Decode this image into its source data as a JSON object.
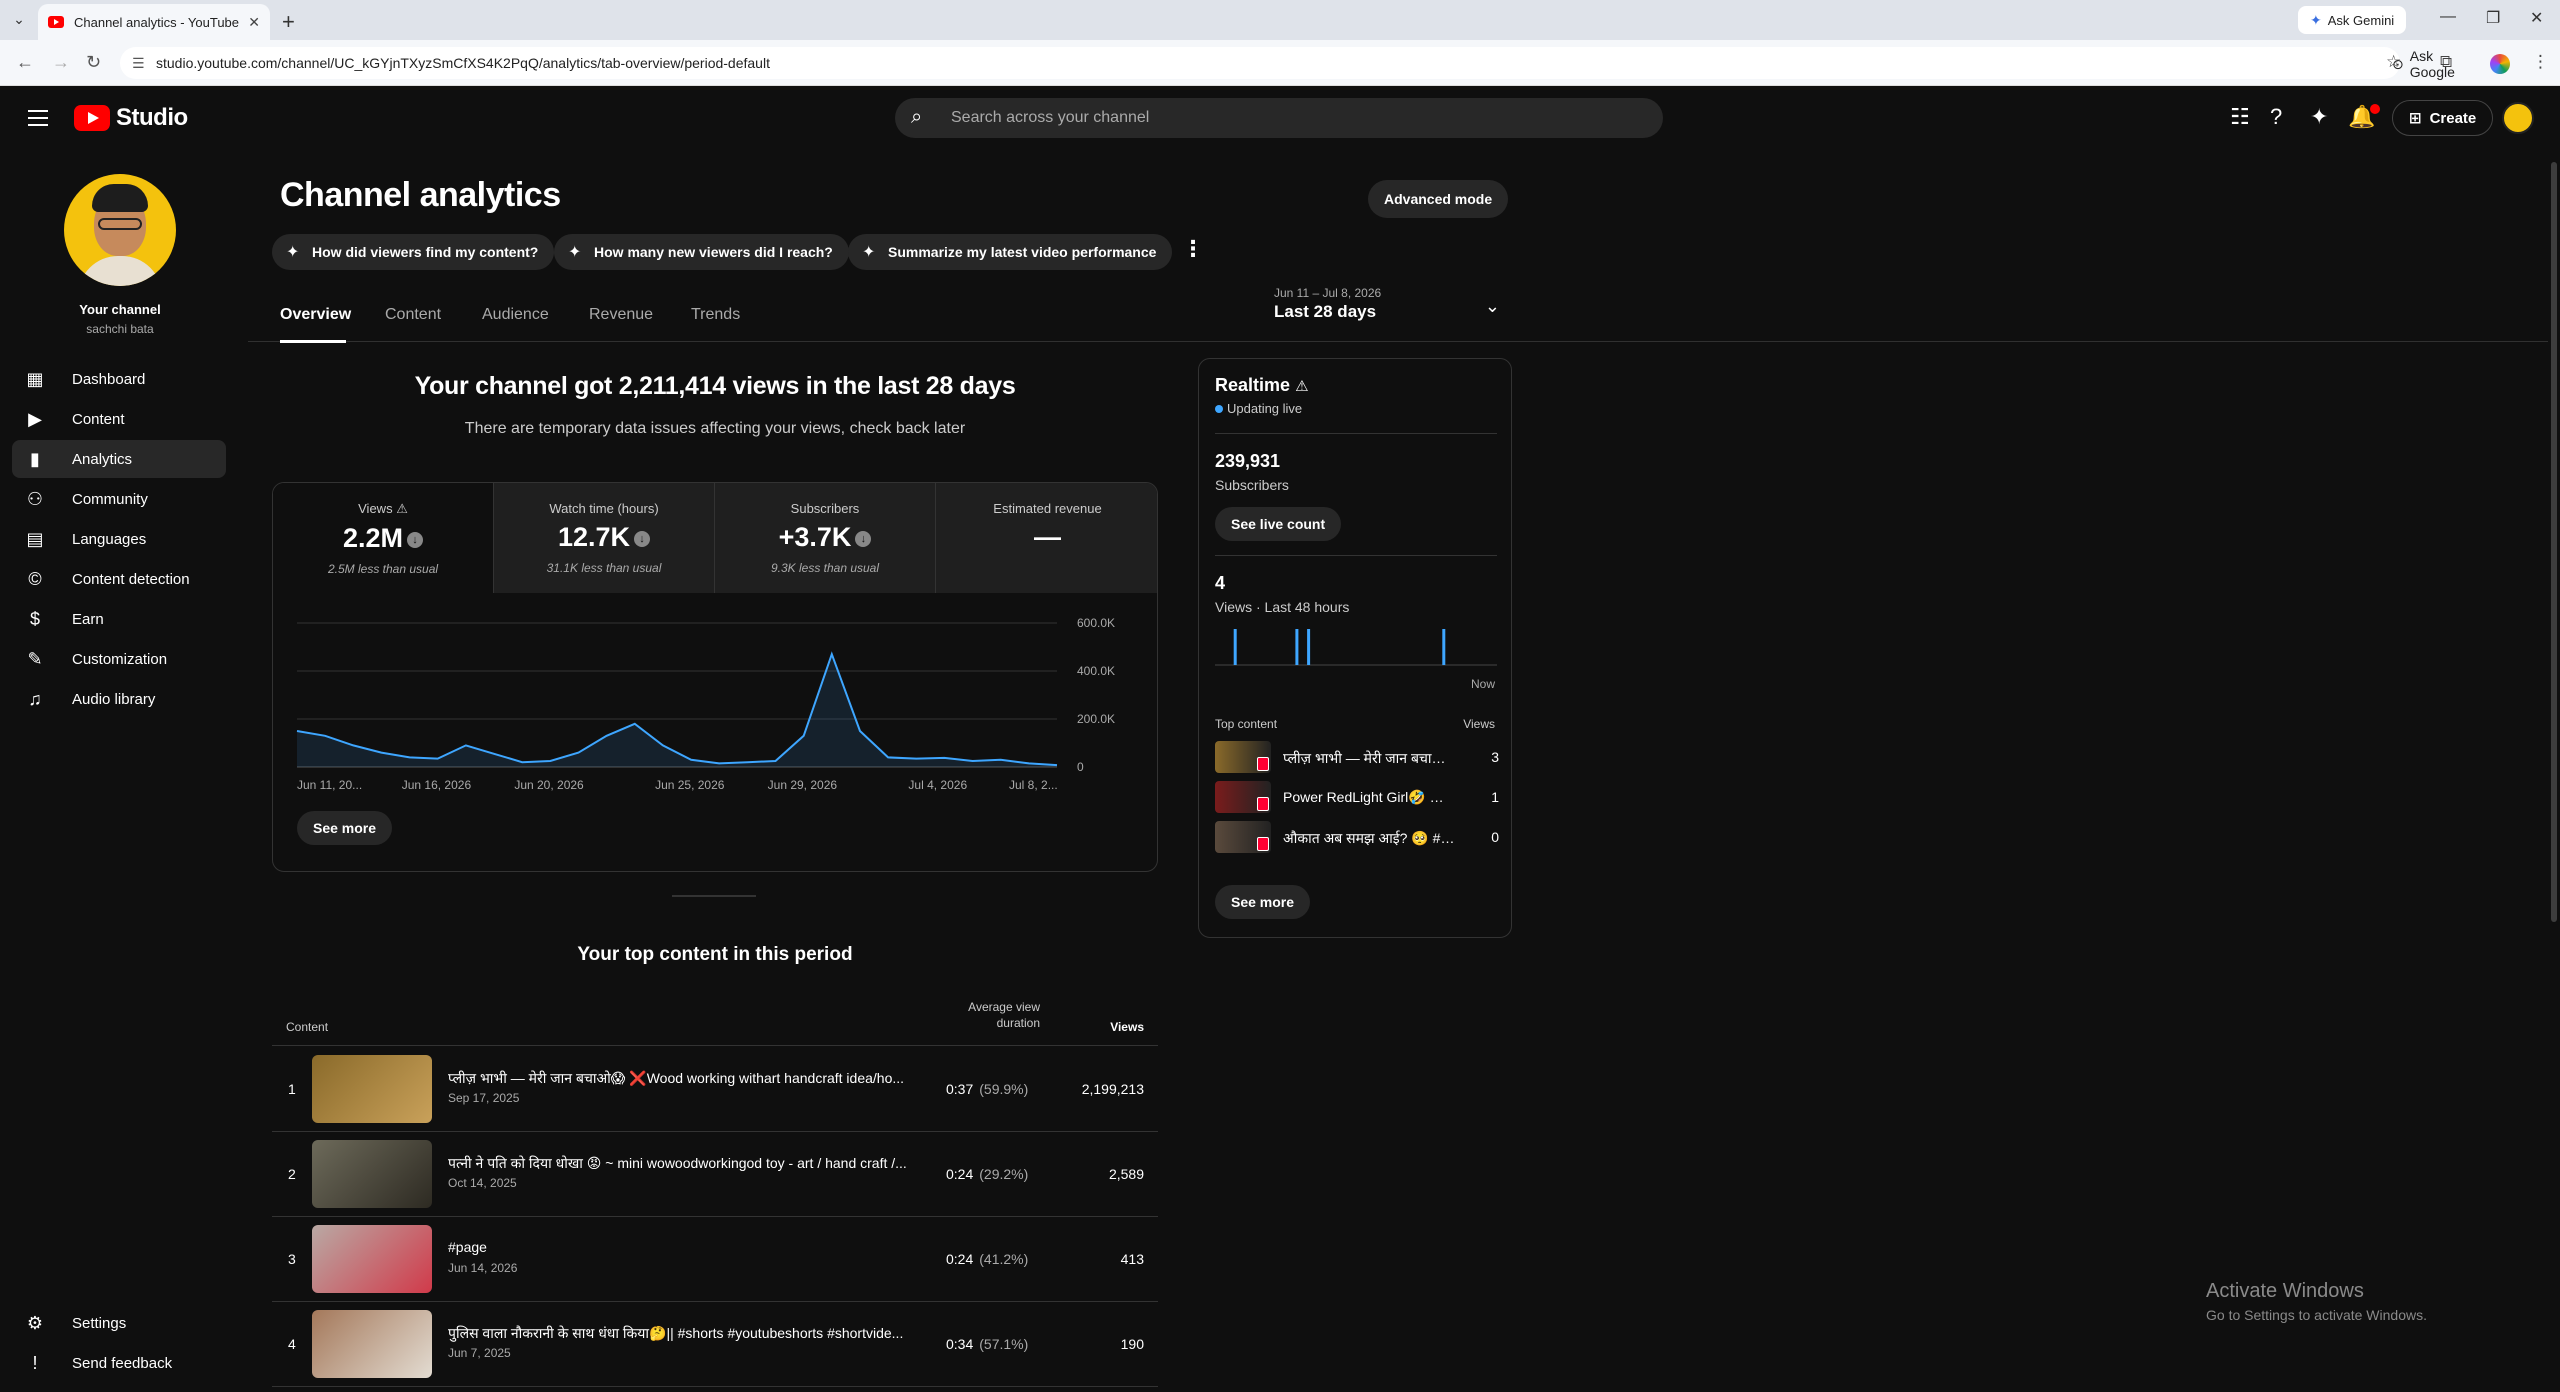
{
  "browser": {
    "tab_title": "Channel analytics - YouTube Studio",
    "url": "studio.youtube.com/channel/UC_kGYjnTXyzSmCfXS4K2PqQ/analytics/tab-overview/period-default",
    "ask_gemini": "Ask Gemini",
    "ask_google": "Ask Google"
  },
  "header": {
    "logo_text": "Studio",
    "search_placeholder": "Search across your channel",
    "create_label": "Create"
  },
  "sidebar": {
    "channel_name": "Your channel",
    "channel_handle": "sachchi bata",
    "items": [
      {
        "label": "Dashboard",
        "icon": "dashboard-icon"
      },
      {
        "label": "Content",
        "icon": "content-icon"
      },
      {
        "label": "Analytics",
        "icon": "analytics-icon",
        "active": true
      },
      {
        "label": "Community",
        "icon": "community-icon"
      },
      {
        "label": "Languages",
        "icon": "languages-icon"
      },
      {
        "label": "Content detection",
        "icon": "copyright-icon"
      },
      {
        "label": "Earn",
        "icon": "dollar-icon"
      },
      {
        "label": "Customization",
        "icon": "magic-wand-icon"
      },
      {
        "label": "Audio library",
        "icon": "audio-library-icon"
      }
    ],
    "settings": "Settings",
    "feedback": "Send feedback"
  },
  "main": {
    "title": "Channel analytics",
    "advanced_mode": "Advanced mode",
    "chips": [
      "How did viewers find my content?",
      "How many new viewers did I reach?",
      "Summarize my latest video performance"
    ],
    "tabs": [
      "Overview",
      "Content",
      "Audience",
      "Revenue",
      "Trends"
    ],
    "date_range_small": "Jun 11 – Jul 8, 2026",
    "date_range_big": "Last 28 days",
    "summary_title": "Your channel got 2,211,414 views in the last 28 days",
    "summary_sub": "There are temporary data issues affecting your views, check back later",
    "metrics": [
      {
        "label": "Views",
        "value": "2.2M",
        "note": "2.5M less than usual",
        "warning": true
      },
      {
        "label": "Watch time (hours)",
        "value": "12.7K",
        "note": "31.1K less than usual"
      },
      {
        "label": "Subscribers",
        "value": "+3.7K",
        "note": "9.3K less than usual"
      },
      {
        "label": "Estimated revenue",
        "value": "—",
        "note": ""
      }
    ],
    "see_more": "See more",
    "top_content_title": "Your top content in this period",
    "top_content_headers": {
      "content": "Content",
      "avg1": "Average view",
      "avg2": "duration",
      "views": "Views"
    },
    "top_content": [
      {
        "rank": "1",
        "title": "प्लीज़ भाभी — मेरी जान बचाओ😱 ❌Wood working withart handcraft idea/ho...",
        "date": "Sep 17, 2025",
        "duration": "0:37",
        "pct": "(59.9%)",
        "views": "2,199,213",
        "thumb": [
          "#8a6a2a",
          "#c9a15a"
        ]
      },
      {
        "rank": "2",
        "title": "पत्नी ने पति को दिया धोखा 😡 ~ mini wowoodworkingod toy - art / hand craft /...",
        "date": "Oct 14, 2025",
        "duration": "0:24",
        "pct": "(29.2%)",
        "views": "2,589",
        "thumb": [
          "#6d6a5a",
          "#2d2a22"
        ]
      },
      {
        "rank": "3",
        "title": "#page",
        "date": "Jun 14, 2026",
        "duration": "0:24",
        "pct": "(41.2%)",
        "views": "413",
        "thumb": [
          "#b9a9a4",
          "#d13a4a"
        ]
      },
      {
        "rank": "4",
        "title": "पुलिस वाला नौकरानी के साथ धंधा किया🤔|| #shorts #youtubeshorts #shortvide...",
        "date": "Jun 7, 2025",
        "duration": "0:34",
        "pct": "(57.1%)",
        "views": "190",
        "thumb": [
          "#a4785a",
          "#e3dcd2"
        ]
      }
    ]
  },
  "realtime": {
    "title": "Realtime",
    "live": "Updating live",
    "subscribers_value": "239,931",
    "subscribers_label": "Subscribers",
    "see_live": "See live count",
    "views_value": "4",
    "views_label": "Views · Last 48 hours",
    "now_label": "Now",
    "bars": [
      0,
      0,
      0,
      0,
      0,
      1,
      0,
      0,
      0,
      0,
      0,
      0,
      0,
      0,
      0,
      0,
      0,
      0,
      0,
      0,
      0,
      0,
      0,
      0,
      0,
      0,
      1,
      0,
      0,
      0,
      1,
      0,
      0,
      0,
      0,
      0,
      0,
      0,
      0,
      0,
      0,
      0,
      0,
      0,
      0,
      0,
      0,
      0,
      0,
      0,
      0,
      0,
      0,
      0,
      0,
      0,
      0,
      0,
      0,
      0,
      0,
      0,
      0,
      0,
      0,
      0,
      0,
      0,
      0,
      0,
      0,
      0,
      0,
      0,
      0,
      0,
      1,
      0,
      0,
      0,
      0,
      0,
      0,
      0,
      0,
      0,
      0,
      0,
      0,
      0,
      0,
      0,
      0,
      0,
      0,
      0
    ],
    "top_content_label": "Top content",
    "views_header": "Views",
    "items": [
      {
        "title": "प्लीज़ भाभी — मेरी जान बचाओ😱 ❌Wood working",
        "views": "3",
        "thumb": "#8a6a2a"
      },
      {
        "title": "Power RedLight Girl🤣 ❌Wood working",
        "views": "1",
        "thumb": "#7a1c1c"
      },
      {
        "title": "औकात अब समझ आई? 🥺 #shorts",
        "views": "0",
        "thumb": "#5a4a3c"
      }
    ],
    "see_more": "See more"
  },
  "chart_data": {
    "type": "area",
    "x": [
      "Jun 11",
      "Jun 12",
      "Jun 13",
      "Jun 14",
      "Jun 15",
      "Jun 16",
      "Jun 17",
      "Jun 18",
      "Jun 19",
      "Jun 20",
      "Jun 21",
      "Jun 22",
      "Jun 23",
      "Jun 24",
      "Jun 25",
      "Jun 26",
      "Jun 27",
      "Jun 28",
      "Jun 29",
      "Jun 30",
      "Jul 1",
      "Jul 2",
      "Jul 3",
      "Jul 4",
      "Jul 5",
      "Jul 6",
      "Jul 7",
      "Jul 8"
    ],
    "values": [
      150000,
      130000,
      90000,
      60000,
      40000,
      35000,
      90000,
      55000,
      20000,
      25000,
      60000,
      130000,
      180000,
      90000,
      30000,
      15000,
      20000,
      25000,
      130000,
      470000,
      150000,
      40000,
      35000,
      38000,
      25000,
      30000,
      15000,
      8000
    ],
    "x_tick_labels": [
      "Jun 11, 20...",
      "Jun 16, 2026",
      "Jun 20, 2026",
      "Jun 25, 2026",
      "Jun 29, 2026",
      "Jul 4, 2026",
      "Jul 8, 2..."
    ],
    "y_tick_labels": [
      "600.0K",
      "400.0K",
      "200.0K",
      "0"
    ],
    "ylim": [
      0,
      600000
    ],
    "grid": true,
    "color": "#3ea6ff"
  },
  "watermark": {
    "line1": "Activate Windows",
    "line2": "Go to Settings to activate Windows."
  }
}
